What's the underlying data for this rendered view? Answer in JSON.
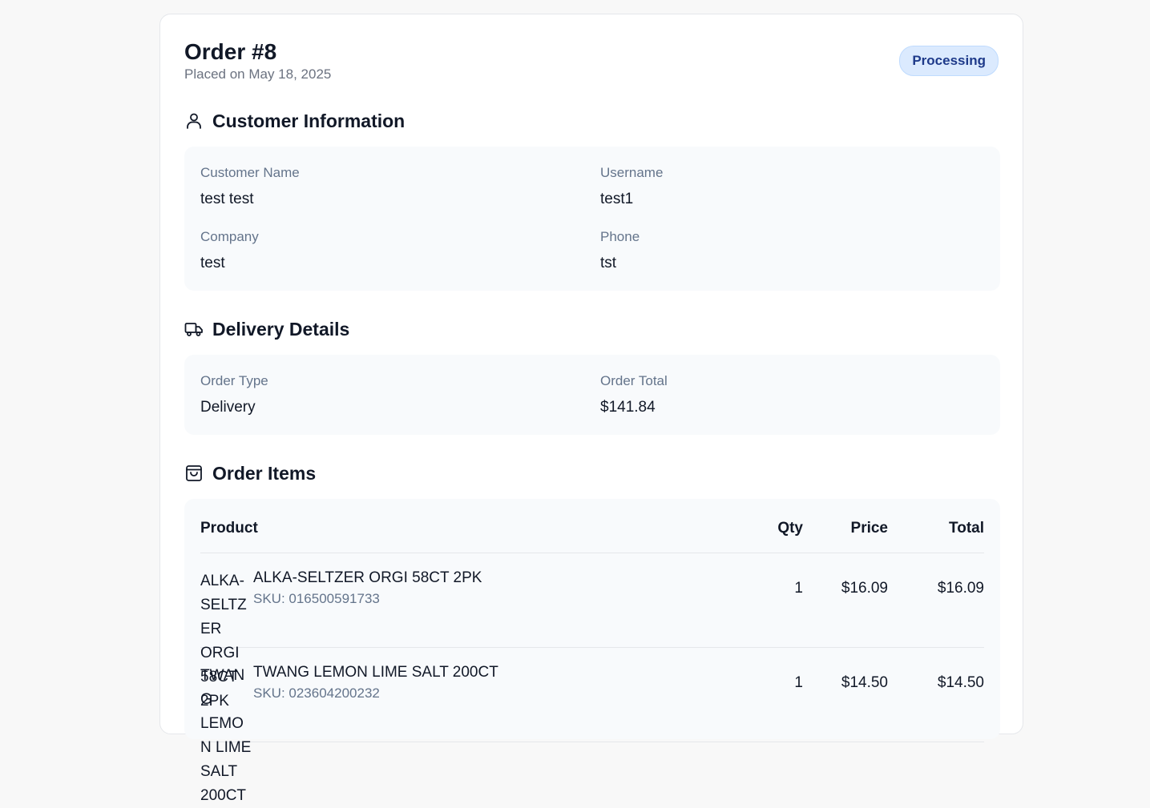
{
  "order": {
    "title": "Order #8",
    "placed": "Placed on May 18, 2025",
    "status": "Processing"
  },
  "customer": {
    "heading": "Customer Information",
    "icon": "user-icon",
    "name_label": "Customer Name",
    "name_value": "test test",
    "username_label": "Username",
    "username_value": "test1",
    "company_label": "Company",
    "company_value": "test",
    "phone_label": "Phone",
    "phone_value": "tst"
  },
  "delivery": {
    "heading": "Delivery Details",
    "icon": "truck-icon",
    "type_label": "Order Type",
    "type_value": "Delivery",
    "total_label": "Order Total",
    "total_value": "$141.84"
  },
  "items": {
    "heading": "Order Items",
    "icon": "shopping-bag-icon",
    "columns": {
      "product": "Product",
      "qty": "Qty",
      "price": "Price",
      "total": "Total"
    },
    "rows": [
      {
        "image_alt": "ALKA-SELTZER ORGI 58CT 2PK",
        "name": "ALKA-SELTZER ORGI 58CT 2PK",
        "sku": "SKU: 016500591733",
        "qty": "1",
        "price": "$16.09",
        "total": "$16.09"
      },
      {
        "image_alt": "TWANG LEMON LIME SALT 200CT",
        "name": "TWANG LEMON LIME SALT 200CT",
        "sku": "SKU: 023604200232",
        "qty": "1",
        "price": "$14.50",
        "total": "$14.50"
      }
    ]
  },
  "colors": {
    "status_bg": "#dbeafe",
    "status_text": "#1e3a8a",
    "panel_bg": "#f8fafc",
    "label": "#64748b"
  }
}
